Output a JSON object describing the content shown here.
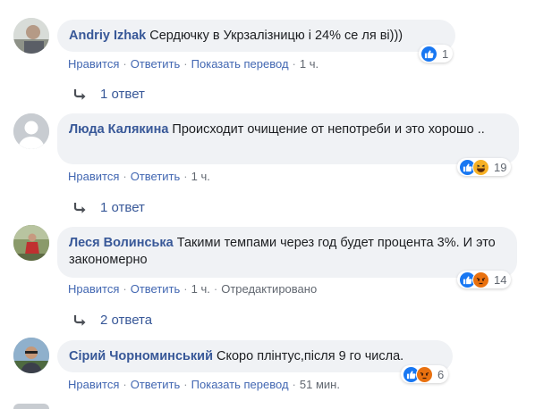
{
  "common": {
    "like_label": "Нравится",
    "reply_label": "Ответить",
    "translate_label": "Показать перевод",
    "separator": "·",
    "edited_label": "Отредактировано"
  },
  "comments": [
    {
      "author": "Andriy Izhak",
      "text": "Сердючку в Укрзалізницю і 24% се ля ві)))",
      "time": "1 ч.",
      "reaction_icons": [
        "like-icon"
      ],
      "reaction_count": "1",
      "replies_label": "1 ответ"
    },
    {
      "author": "Люда Калякина",
      "text": "Происходит очищение от непотреби и это хорошо ..",
      "time": "1 ч.",
      "reaction_icons": [
        "like-icon",
        "haha-icon"
      ],
      "reaction_count": "19",
      "replies_label": "1 ответ"
    },
    {
      "author": "Леся Волинська",
      "text": "Такими темпами через год будет процента 3%. И это закономерно",
      "time": "1 ч.",
      "reaction_icons": [
        "like-icon",
        "angry-icon"
      ],
      "reaction_count": "14",
      "replies_label": "2 ответа"
    },
    {
      "author": "Сірий Чорноминський",
      "text": "Скоро плінтус,після 9 го числа.",
      "time": "51 мин.",
      "reaction_icons": [
        "like-icon",
        "angry-icon"
      ],
      "reaction_count": "6"
    }
  ],
  "colors": {
    "author": "#385898",
    "link": "#4267b2",
    "bubble": "#f0f2f5",
    "like": "#1877f2",
    "haha": "#f7b125",
    "angry": "#e9710f"
  }
}
